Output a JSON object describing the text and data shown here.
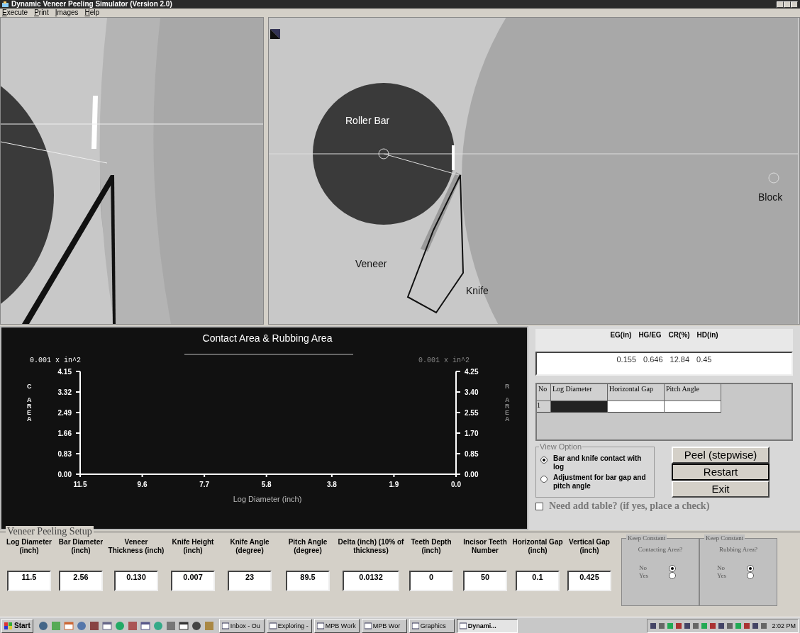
{
  "window": {
    "title": "Dynamic Veneer Peeling Simulator (Version 2.0)"
  },
  "menu": [
    {
      "label": "Execute"
    },
    {
      "label": "Print"
    },
    {
      "label": "Images"
    },
    {
      "label": "Help"
    }
  ],
  "right_view": {
    "labels": [
      {
        "kind": "roller",
        "text": "Roller Bar"
      },
      {
        "kind": "veneer",
        "text": "Veneer"
      },
      {
        "kind": "knife",
        "text": "Knife"
      },
      {
        "kind": "block",
        "text": "Block"
      }
    ]
  },
  "chart": {
    "left_unit": "0.001 x in^2",
    "right_unit": "0.001 x in^2",
    "left_letters": [
      "C",
      "AREA"
    ],
    "right_letters": [
      "R",
      "AREA"
    ],
    "right_ticks": [
      "4.25",
      "3.40",
      "2.55",
      "1.70",
      "0.85",
      "0.00"
    ],
    "chart_data": {
      "type": "line",
      "title": "Contact Area & Rubbing Area",
      "xlabel": "Log Diameter (inch)",
      "xlim": [
        11.5,
        0
      ],
      "ylim": [
        0,
        4.15
      ],
      "xticks": [
        {
          "value": 11.5,
          "label": "11.5"
        },
        {
          "value": 9.6,
          "label": "9.6"
        },
        {
          "value": 7.7,
          "label": "7.7"
        },
        {
          "value": 5.8,
          "label": "5.8"
        },
        {
          "value": 3.8,
          "label": "3.8"
        },
        {
          "value": 1.9,
          "label": "1.9"
        },
        {
          "value": 0,
          "label": "0.0"
        }
      ],
      "yticks": [
        {
          "value": 0,
          "label": "0.00"
        },
        {
          "value": 0.83,
          "label": "0.83"
        },
        {
          "value": 1.66,
          "label": "1.66"
        },
        {
          "value": 2.49,
          "label": "2.49"
        },
        {
          "value": 3.32,
          "label": "3.32"
        },
        {
          "value": 4.15,
          "label": "4.15"
        }
      ]
    }
  },
  "results": {
    "headers": [
      "EG(in)",
      "HG/EG",
      "CR(%)",
      "HD(in)"
    ],
    "values": [
      "0.155",
      "0.646",
      "12.84",
      "0.45"
    ]
  },
  "table": {
    "columns": [
      "No",
      "Log Diameter",
      "Horizontal Gap",
      "Pitch Angle"
    ],
    "rows": [
      {
        "no": "1",
        "cells": [
          {
            "selected": true
          },
          {
            "selected": false
          },
          {
            "selected": false
          }
        ]
      }
    ]
  },
  "view_option": {
    "title": "View Option",
    "options": [
      {
        "label": "Bar and knife contact with log",
        "selected": true
      },
      {
        "label": "Adjustment for bar gap and pitch angle",
        "selected": false
      }
    ]
  },
  "buttons": [
    {
      "label": "Peel (stepwise)",
      "focused": false
    },
    {
      "label": "Restart",
      "focused": true
    },
    {
      "label": "Exit",
      "focused": false
    }
  ],
  "add_table": {
    "label": "Need add table? (if yes, place a check)",
    "checked": false
  },
  "setup": {
    "title": "Veneer Peeling Setup",
    "fields": [
      {
        "label": "Log Diameter (inch)",
        "value": "11.5"
      },
      {
        "label": "Bar Diameter (inch)",
        "value": "2.56"
      },
      {
        "label": "Veneer Thickness (inch)",
        "value": "0.130"
      },
      {
        "label": "Knife Height (inch)",
        "value": "0.007"
      },
      {
        "label": "Knife Angle (degree)",
        "value": "23"
      },
      {
        "label": "Pitch Angle (degree)",
        "value": "89.5"
      },
      {
        "label": "Delta (inch) (10% of thickness)",
        "value": "0.0132"
      },
      {
        "label": "Teeth Depth (inch)",
        "value": "0"
      },
      {
        "label": "Incisor Teeth Number",
        "value": "50"
      },
      {
        "label": "Horizontal Gap (inch)",
        "value": "0.1"
      },
      {
        "label": "Vertical Gap (inch)",
        "value": "0.425"
      }
    ],
    "keep_constant": [
      {
        "title": "Keep Constant",
        "question": "Contacting Area?",
        "options": [
          {
            "label": "No",
            "selected": true
          },
          {
            "label": "Yes",
            "selected": false
          }
        ]
      },
      {
        "title": "Keep Constant",
        "question": "Rubbing Area?",
        "options": [
          {
            "label": "No",
            "selected": true
          },
          {
            "label": "Yes",
            "selected": false
          }
        ]
      }
    ]
  },
  "taskbar": {
    "start": "Start",
    "tasks": [
      {
        "label": "Inbox - Ou",
        "selected": false
      },
      {
        "label": "Exploring -",
        "selected": false
      },
      {
        "label": "MPB Work",
        "selected": false
      },
      {
        "label": "MPB Wor",
        "selected": false
      },
      {
        "label": "Graphics",
        "selected": false
      },
      {
        "label": "Dynami...",
        "selected": true
      }
    ],
    "clock": "2:02 PM"
  }
}
